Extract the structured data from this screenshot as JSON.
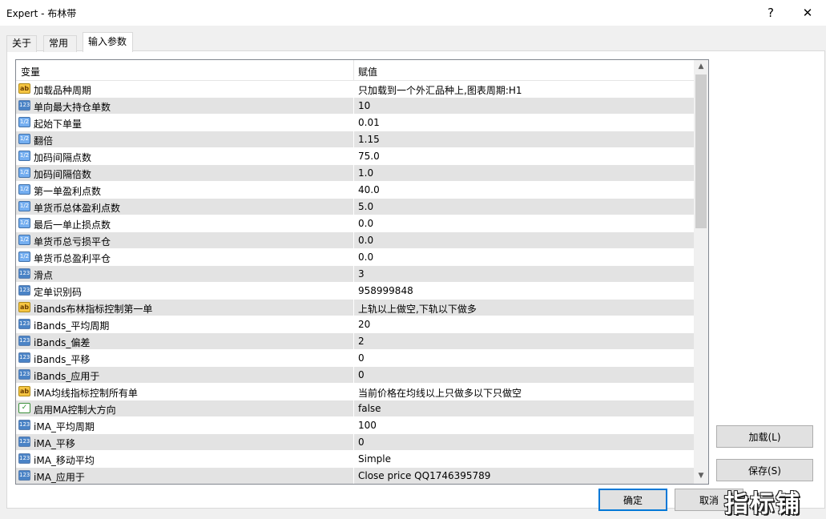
{
  "window": {
    "title": "Expert - 布林带",
    "help_icon": "?",
    "close_icon": "✕"
  },
  "tabs": [
    {
      "label": "关于"
    },
    {
      "label": "常用"
    },
    {
      "label": "输入参数",
      "active": true
    }
  ],
  "grid": {
    "columns": {
      "variable": "变量",
      "value": "赋值"
    },
    "rows": [
      {
        "type": "string",
        "icon": "ab",
        "name": "加载品种周期",
        "value": "只加载到一个外汇品种上,图表周期:H1"
      },
      {
        "type": "int",
        "icon": "123",
        "name": "单向最大持仓单数",
        "value": "10"
      },
      {
        "type": "double",
        "icon": "1/2",
        "name": "起始下单量",
        "value": "0.01"
      },
      {
        "type": "double",
        "icon": "1/2",
        "name": "翻倍",
        "value": "1.15"
      },
      {
        "type": "double",
        "icon": "1/2",
        "name": "加码间隔点数",
        "value": "75.0"
      },
      {
        "type": "double",
        "icon": "1/2",
        "name": "加码间隔倍数",
        "value": "1.0"
      },
      {
        "type": "double",
        "icon": "1/2",
        "name": "第一单盈利点数",
        "value": "40.0"
      },
      {
        "type": "double",
        "icon": "1/2",
        "name": "单货币总体盈利点数",
        "value": "5.0"
      },
      {
        "type": "double",
        "icon": "1/2",
        "name": "最后一单止损点数",
        "value": "0.0"
      },
      {
        "type": "double",
        "icon": "1/2",
        "name": "单货币总亏损平仓",
        "value": "0.0"
      },
      {
        "type": "double",
        "icon": "1/2",
        "name": "单货币总盈利平仓",
        "value": "0.0"
      },
      {
        "type": "int",
        "icon": "123",
        "name": "滑点",
        "value": "3"
      },
      {
        "type": "int",
        "icon": "123",
        "name": "定单识别码",
        "value": "958999848"
      },
      {
        "type": "string",
        "icon": "ab",
        "name": "iBands布林指标控制第一单",
        "value": "上轨以上做空,下轨以下做多"
      },
      {
        "type": "int",
        "icon": "123",
        "name": "iBands_平均周期",
        "value": "20"
      },
      {
        "type": "int",
        "icon": "123",
        "name": "iBands_偏差",
        "value": "2"
      },
      {
        "type": "int",
        "icon": "123",
        "name": "iBands_平移",
        "value": "0"
      },
      {
        "type": "int",
        "icon": "123",
        "name": "iBands_应用于",
        "value": "0"
      },
      {
        "type": "string",
        "icon": "ab",
        "name": "iMA均线指标控制所有单",
        "value": "当前价格在均线以上只做多以下只做空"
      },
      {
        "type": "bool",
        "icon": "✓",
        "name": "启用MA控制大方向",
        "value": "false"
      },
      {
        "type": "int",
        "icon": "123",
        "name": "iMA_平均周期",
        "value": "100"
      },
      {
        "type": "int",
        "icon": "123",
        "name": "iMA_平移",
        "value": "0"
      },
      {
        "type": "int",
        "icon": "123",
        "name": "iMA_移动平均",
        "value": "Simple"
      },
      {
        "type": "int",
        "icon": "123",
        "name": "iMA_应用于",
        "value": "Close price    QQ1746395789"
      }
    ],
    "scrollbar": {
      "up": "▲",
      "down": "▼"
    }
  },
  "buttons": {
    "load": "加载(L)",
    "save": "保存(S)",
    "ok": "确定",
    "cancel": "取消"
  },
  "watermark": "指标铺"
}
